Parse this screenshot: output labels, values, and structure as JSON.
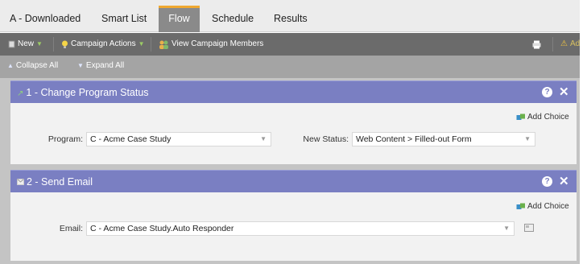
{
  "tabs": [
    {
      "label": "A - Downloaded"
    },
    {
      "label": "Smart List"
    },
    {
      "label": "Flow",
      "active": true
    },
    {
      "label": "Schedule"
    },
    {
      "label": "Results"
    }
  ],
  "toolbar": {
    "new_label": "New",
    "campaign_actions_label": "Campaign Actions",
    "view_members_label": "View Campaign Members",
    "right_label": "Ad"
  },
  "collapsebar": {
    "collapse_label": "Collapse All",
    "expand_label": "Expand All"
  },
  "steps": [
    {
      "title": "1 - Change Program Status",
      "add_choice": "Add Choice",
      "fields": [
        {
          "label": "Program:",
          "value": "C - Acme Case Study"
        },
        {
          "label": "New Status:",
          "value": "Web Content > Filled-out Form"
        }
      ]
    },
    {
      "title": "2 - Send Email",
      "add_choice": "Add Choice",
      "fields": [
        {
          "label": "Email:",
          "value": "C - Acme Case Study.Auto Responder"
        }
      ]
    }
  ],
  "colors": {
    "step_header": "#7a7fc2",
    "active_tab_accent": "#f0a830",
    "toolbar": "#6b6b6b"
  }
}
